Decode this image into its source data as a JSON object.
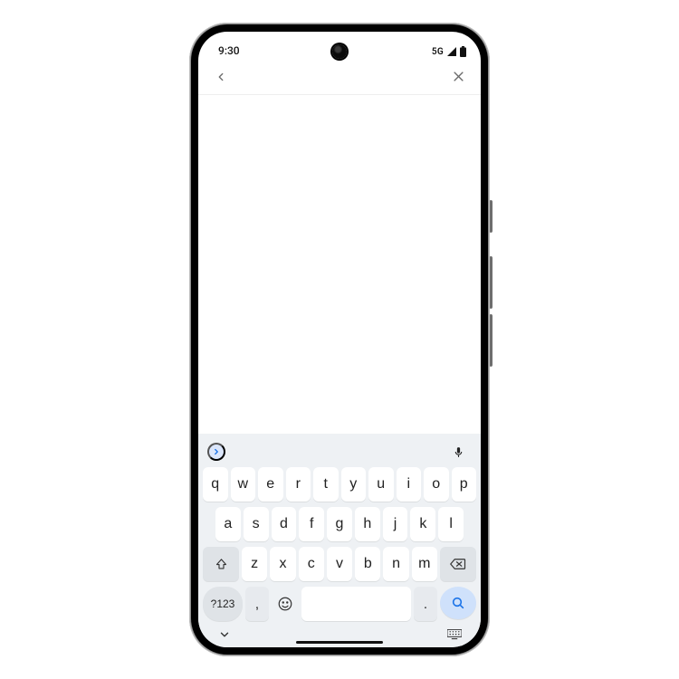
{
  "status": {
    "time": "9:30",
    "network_label": "5G"
  },
  "appbar": {
    "back_icon": "chevron-left",
    "close_icon": "x"
  },
  "keyboard": {
    "expand_label": ">",
    "mic_label": "mic",
    "row1": [
      "q",
      "w",
      "e",
      "r",
      "t",
      "y",
      "u",
      "i",
      "o",
      "p"
    ],
    "row2": [
      "a",
      "s",
      "d",
      "f",
      "g",
      "h",
      "j",
      "k",
      "l"
    ],
    "row3": [
      "z",
      "x",
      "c",
      "v",
      "b",
      "n",
      "m"
    ],
    "shift_label": "⇧",
    "backspace_label": "⌫",
    "symbols_label": "?123",
    "comma_label": ",",
    "emoji_label": "☺",
    "period_label": ".",
    "search_label": "🔍",
    "collapse_label": "⌄",
    "switcher_label": "⌨"
  }
}
